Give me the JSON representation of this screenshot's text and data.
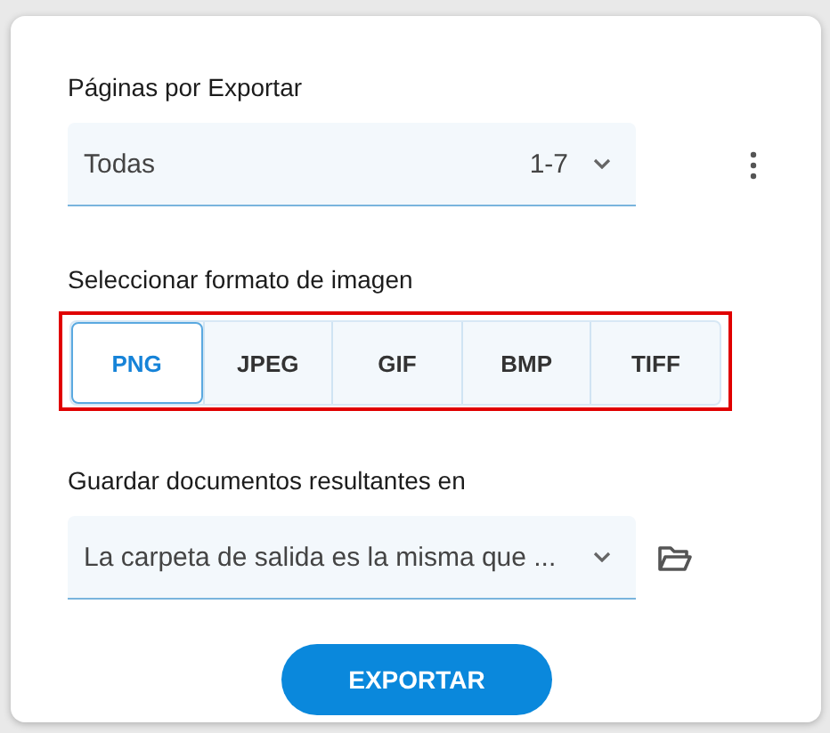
{
  "pages": {
    "label": "Páginas por Exportar",
    "value": "Todas",
    "range": "1-7"
  },
  "format": {
    "label": "Seleccionar formato de imagen",
    "highlighted": true,
    "options": [
      {
        "label": "PNG",
        "selected": true
      },
      {
        "label": "JPEG",
        "selected": false
      },
      {
        "label": "GIF",
        "selected": false
      },
      {
        "label": "BMP",
        "selected": false
      },
      {
        "label": "TIFF",
        "selected": false
      }
    ]
  },
  "output": {
    "label": "Guardar documentos resultantes en",
    "value": "La carpeta de salida es la misma que ..."
  },
  "button": "EXPORTAR"
}
